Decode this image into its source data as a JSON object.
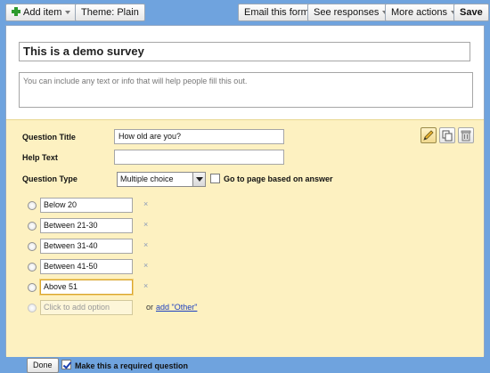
{
  "toolbar": {
    "add_item": "Add item",
    "theme": "Theme:  Plain",
    "email_form": "Email this form",
    "see_responses": "See responses",
    "more_actions": "More actions",
    "save": "Save"
  },
  "form": {
    "title": "This is a demo survey",
    "description_placeholder": "You can include any text or info that will help people fill this out."
  },
  "question": {
    "title_label": "Question Title",
    "title_value": "How old are you?",
    "help_label": "Help Text",
    "help_value": "",
    "type_label": "Question Type",
    "type_value": "Multiple choice",
    "goto_label": "Go to page based on answer",
    "options": [
      "Below 20",
      "Between 21-30",
      "Between 31-40",
      "Between 41-50",
      "Above 51"
    ],
    "remove_mark": "×",
    "add_option_placeholder": "Click to add option",
    "or_text": "or",
    "add_other_link": "add \"Other\"",
    "done": "Done",
    "required_label": "Make this a required question"
  }
}
